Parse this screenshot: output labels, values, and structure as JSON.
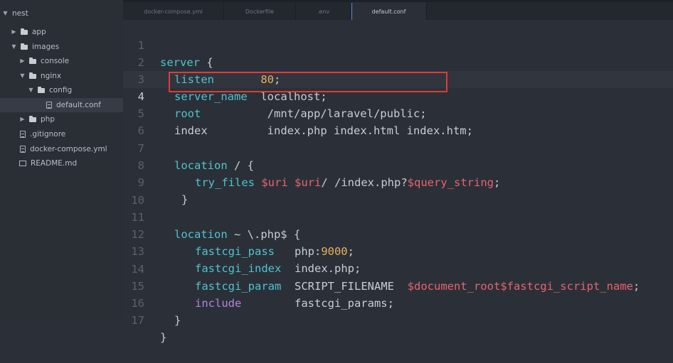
{
  "sidebar": {
    "items": [
      {
        "label": "nest",
        "kind": "folder-open"
      },
      {
        "label": "app",
        "kind": "folder-closed"
      },
      {
        "label": "images",
        "kind": "folder-open"
      },
      {
        "label": "console",
        "kind": "folder-closed"
      },
      {
        "label": "nginx",
        "kind": "folder-open"
      },
      {
        "label": "config",
        "kind": "folder-open"
      },
      {
        "label": "default.conf",
        "kind": "file",
        "selected": true
      },
      {
        "label": "php",
        "kind": "folder-closed"
      },
      {
        "label": ".gitignore",
        "kind": "file"
      },
      {
        "label": "docker-compose.yml",
        "kind": "file"
      },
      {
        "label": "README.md",
        "kind": "book"
      }
    ]
  },
  "tabs": [
    {
      "label": "docker-compose.yml"
    },
    {
      "label": "Dockerfile"
    },
    {
      "label": ".env"
    },
    {
      "label": "default.conf",
      "active": true
    }
  ],
  "editor": {
    "current_line": 4,
    "line_numbers": [
      "1",
      "2",
      "3",
      "4",
      "5",
      "6",
      "7",
      "8",
      "9",
      "10",
      "11",
      "12",
      "13",
      "14",
      "15",
      "16",
      "17"
    ],
    "code": {
      "l1_kw": "server",
      "l1_brace": " {",
      "l2_kw": "listen",
      "l2_val": "80",
      "l2_semi": ";",
      "l3_kw": "server_name",
      "l3_val": "localhost;",
      "l4_kw": "root",
      "l4_val": "/mnt/app/laravel/public;",
      "l5_kw": "index",
      "l5_val": "index.php index.html index.htm;",
      "l7_kw": "location",
      "l7_val": " / {",
      "l8_kw": "try_files",
      "l8_v1": "$uri",
      "l8_v2": "$uri",
      "l8_t": "/ /index.php?",
      "l8_v3": "$query_string",
      "l8_semi": ";",
      "l9": "}",
      "l11_kw": "location",
      "l11_val": " ~ \\.php$ {",
      "l12_kw": "fastcgi_pass",
      "l12_t": "php:",
      "l12_n": "9000",
      "l12_semi": ";",
      "l13_kw": "fastcgi_index",
      "l13_val": "index.php;",
      "l14_kw": "fastcgi_param",
      "l14_t": "SCRIPT_FILENAME",
      "l14_v": "$document_root$fastcgi_script_name",
      "l14_semi": ";",
      "l15_kw": "include",
      "l15_val": "fastcgi_params;",
      "l16": "}",
      "l17": "}"
    },
    "highlight_color": "#e03a36"
  }
}
